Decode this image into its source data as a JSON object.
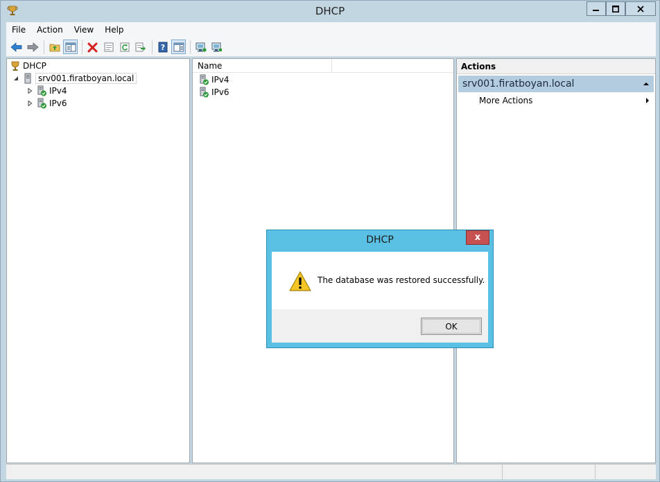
{
  "window": {
    "title": "DHCP",
    "icon": "dhcp-trophy-icon"
  },
  "menu": {
    "items": [
      "File",
      "Action",
      "View",
      "Help"
    ]
  },
  "toolbar": {
    "buttons": [
      "back-arrow-icon",
      "forward-arrow-icon",
      "up-folder-icon",
      "show-hide-tree-icon",
      "delete-icon",
      "properties-icon",
      "refresh-icon",
      "export-list-icon",
      "help-icon",
      "show-hide-action-pane-icon",
      "server-authorize-icon",
      "server-unauthorize-icon"
    ]
  },
  "tree": {
    "root": "DHCP",
    "server": "srv001.firatboyan.local",
    "children": [
      "IPv4",
      "IPv6"
    ]
  },
  "list": {
    "columns": [
      "Name"
    ],
    "rows": [
      "IPv4",
      "IPv6"
    ]
  },
  "actions": {
    "header": "Actions",
    "group": "srv001.firatboyan.local",
    "more": "More Actions"
  },
  "dialog": {
    "title": "DHCP",
    "message": "The database was restored successfully.",
    "ok": "OK",
    "close": "x",
    "icon": "warning-icon"
  },
  "colors": {
    "dialog_frame": "#5ac1e5",
    "close_button": "#c75050",
    "action_group": "#b4cce0"
  }
}
